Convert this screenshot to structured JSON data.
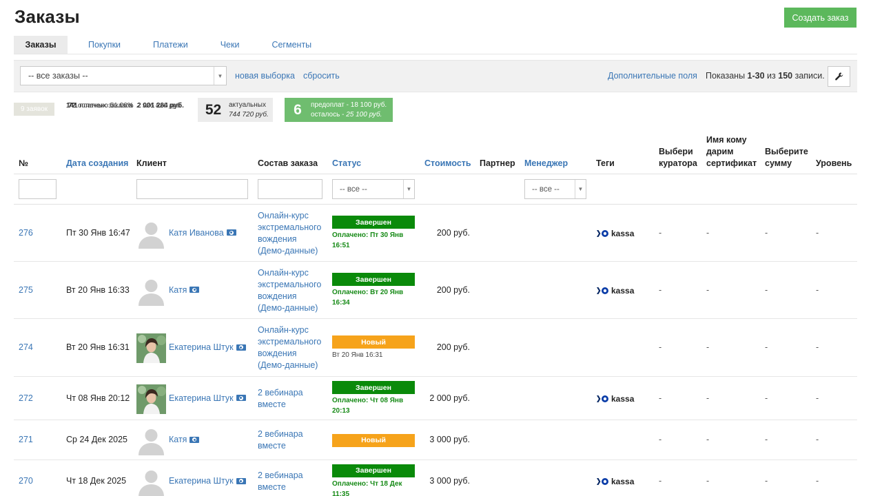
{
  "header": {
    "title": "Заказы",
    "create_button": "Создать заказ"
  },
  "tabs": [
    {
      "label": "Заказы",
      "active": true
    },
    {
      "label": "Покупки",
      "active": false
    },
    {
      "label": "Платежи",
      "active": false
    },
    {
      "label": "Чеки",
      "active": false
    },
    {
      "label": "Сегменты",
      "active": false
    }
  ],
  "filterbar": {
    "selection": "-- все заказы --",
    "new_selection": "новая выборка",
    "reset": "сбросить",
    "extra_fields": "Дополнительные поля",
    "shown_prefix": "Показаны ",
    "shown_range": "1-30",
    "shown_mid": " из ",
    "shown_total": "150",
    "shown_suffix": " записи."
  },
  "stats": {
    "requests_badge": "9 заявок",
    "paid_orders_count": "141",
    "paid_orders_label": "платных заказов",
    "paid_orders_sum": "2 926 820 руб.",
    "paid_count": "72",
    "paid_label": "оплачено 51.06%",
    "paid_sum": "2 001 264 руб.",
    "actual_count": "52",
    "actual_label": "актуальных",
    "actual_sum": "744 720 руб.",
    "prepay_count": "6",
    "prepay_label": "предоплат - 18 100 руб.",
    "prepay_left_label": "осталось - ",
    "prepay_left_sum": "25 100 руб."
  },
  "columns": {
    "num": "№",
    "created": "Дата создания",
    "client": "Клиент",
    "composition": "Состав заказа",
    "status": "Статус",
    "cost": "Стоимость",
    "partner": "Партнер",
    "manager": "Менеджер",
    "tags": "Теги",
    "curator_1": "Выбери",
    "curator_2": "куратора",
    "gift_1": "Имя кому",
    "gift_2": "дарим",
    "gift_3": "сертификат",
    "sum_1": "Выберите",
    "sum_2": "сумму",
    "level": "Уровень"
  },
  "column_filters": {
    "status_select": "-- все --",
    "manager_select": "-- все --"
  },
  "rows": [
    {
      "num": "276",
      "date": "Пт 30 Янв 16:47",
      "client": "Катя Иванова",
      "avatar": "placeholder",
      "composition": [
        "Онлайн-курс",
        "экстремального",
        "вождения",
        "(Демо-данные)"
      ],
      "status": "Завершен",
      "status_type": "done",
      "status_note": [
        "Оплачено: Пт 30 Янв",
        "16:51"
      ],
      "price": "200 руб.",
      "kassa": true,
      "kassa_label": "kassa",
      "curator": "-",
      "gift": "-",
      "sum": "-",
      "level": "-"
    },
    {
      "num": "275",
      "date": "Вт 20 Янв 16:33",
      "client": "Катя",
      "avatar": "placeholder",
      "composition": [
        "Онлайн-курс",
        "экстремального",
        "вождения",
        "(Демо-данные)"
      ],
      "status": "Завершен",
      "status_type": "done",
      "status_note": [
        "Оплачено: Вт 20 Янв",
        "16:34"
      ],
      "price": "200 руб.",
      "kassa": true,
      "kassa_label": "kassa",
      "curator": "-",
      "gift": "-",
      "sum": "-",
      "level": "-"
    },
    {
      "num": "274",
      "date": "Вт 20 Янв 16:31",
      "client": "Екатерина Штук",
      "avatar": "photo",
      "composition": [
        "Онлайн-курс",
        "экстремального",
        "вождения",
        "(Демо-данные)"
      ],
      "status": "Новый",
      "status_type": "new",
      "status_note": [
        "Вт 20 Янв 16:31"
      ],
      "price": "200 руб.",
      "kassa": false,
      "kassa_label": "",
      "curator": "-",
      "gift": "-",
      "sum": "-",
      "level": "-"
    },
    {
      "num": "272",
      "date": "Чт 08 Янв 20:12",
      "client": "Екатерина Штук",
      "avatar": "photo",
      "composition": [
        "2 вебинара",
        "вместе"
      ],
      "status": "Завершен",
      "status_type": "done",
      "status_note": [
        "Оплачено: Чт 08 Янв",
        "20:13"
      ],
      "price": "2 000 руб.",
      "kassa": true,
      "kassa_label": "kassa",
      "curator": "-",
      "gift": "-",
      "sum": "-",
      "level": "-"
    },
    {
      "num": "271",
      "date": "Ср 24 Дек 2025",
      "client": "Катя",
      "avatar": "placeholder",
      "composition": [
        "2 вебинара",
        "вместе"
      ],
      "status": "Новый",
      "status_type": "new",
      "status_note": [],
      "price": "3 000 руб.",
      "kassa": false,
      "kassa_label": "",
      "curator": "-",
      "gift": "-",
      "sum": "-",
      "level": "-"
    },
    {
      "num": "270",
      "date": "Чт 18 Дек 2025",
      "client": "Екатерина Штук",
      "avatar": "placeholder",
      "composition": [
        "2 вебинара",
        "вместе"
      ],
      "status": "Завершен",
      "status_type": "done",
      "status_note": [
        "Оплачено: Чт 18 Дек",
        "11:35"
      ],
      "price": "3 000 руб.",
      "kassa": true,
      "kassa_label": "kassa",
      "curator": "-",
      "gift": "-",
      "sum": "-",
      "level": "-"
    }
  ],
  "colors": {
    "link": "#3a76b5",
    "done": "#0a8a0a",
    "new": "#f6a31b",
    "create": "#5cb85c",
    "prepay": "#6fbd6f"
  }
}
